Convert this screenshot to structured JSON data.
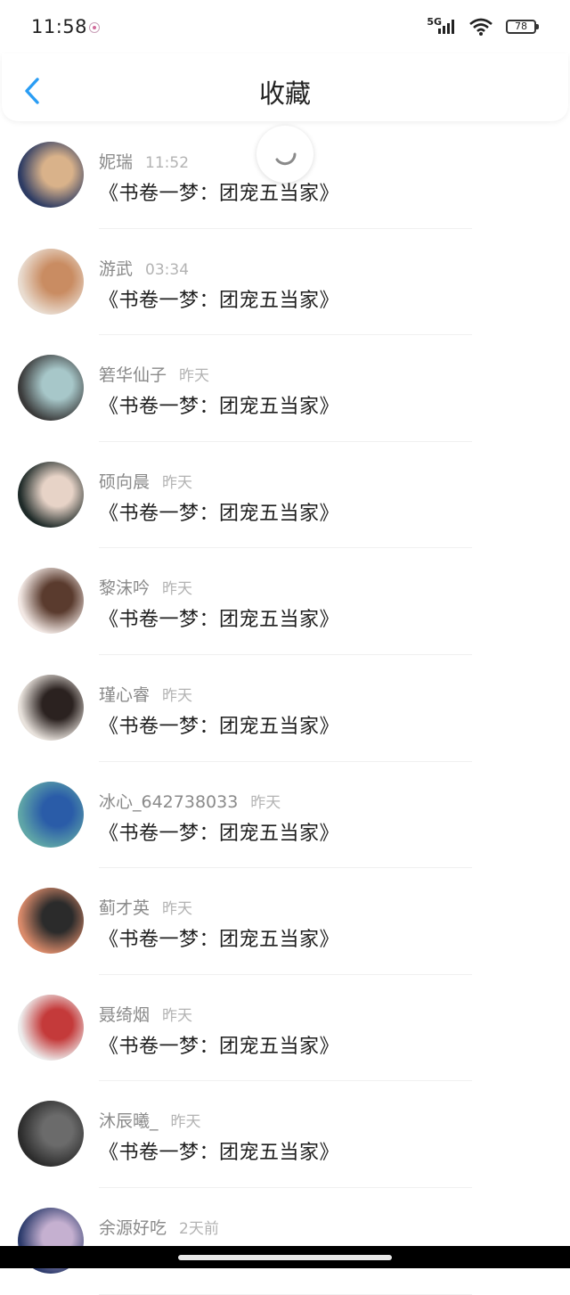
{
  "status_bar": {
    "time": "11:58",
    "network": "5G",
    "battery": "78",
    "icons": [
      "notification-icon",
      "signal-icon",
      "wifi-icon",
      "battery-icon"
    ]
  },
  "header": {
    "title": "收藏",
    "back_icon": "chevron-left-icon",
    "accent_color": "#2a9df4"
  },
  "favorites": [
    {
      "name": "妮瑞",
      "time": "11:52",
      "message": "《书卷一梦：团宠五当家》",
      "avatar_colors": [
        "#2d3b63",
        "#d9b28a"
      ]
    },
    {
      "name": "游武",
      "time": "03:34",
      "message": "《书卷一梦：团宠五当家》",
      "avatar_colors": [
        "#e9dcd0",
        "#c98c62"
      ]
    },
    {
      "name": "箬华仙子",
      "time": "昨天",
      "message": "《书卷一梦：团宠五当家》",
      "avatar_colors": [
        "#3a3a3a",
        "#a7c7c9"
      ]
    },
    {
      "name": "硕向晨",
      "time": "昨天",
      "message": "《书卷一梦：团宠五当家》",
      "avatar_colors": [
        "#1e2a28",
        "#e7d3c7"
      ]
    },
    {
      "name": "黎沫吟",
      "time": "昨天",
      "message": "《书卷一梦：团宠五当家》",
      "avatar_colors": [
        "#f2e8e4",
        "#5a3b2e"
      ]
    },
    {
      "name": "瑾心睿",
      "time": "昨天",
      "message": "《书卷一梦：团宠五当家》",
      "avatar_colors": [
        "#e8e2dc",
        "#2b2220"
      ]
    },
    {
      "name": "冰心_642738033",
      "time": "昨天",
      "message": "《书卷一梦：团宠五当家》",
      "avatar_colors": [
        "#5fa5a7",
        "#2a5ca8"
      ]
    },
    {
      "name": "蓟才英",
      "time": "昨天",
      "message": "《书卷一梦：团宠五当家》",
      "avatar_colors": [
        "#d98a6a",
        "#2b2b2b"
      ]
    },
    {
      "name": "聂绮烟",
      "time": "昨天",
      "message": "《书卷一梦：团宠五当家》",
      "avatar_colors": [
        "#ededed",
        "#c43a3a"
      ]
    },
    {
      "name": "沐辰曦_",
      "time": "昨天",
      "message": "《书卷一梦：团宠五当家》",
      "avatar_colors": [
        "#2c2c2c",
        "#6b6b6b"
      ]
    },
    {
      "name": "余源好吃",
      "time": "2天前",
      "message": "",
      "avatar_colors": [
        "#2b3a6b",
        "#c5b0d0"
      ]
    }
  ]
}
